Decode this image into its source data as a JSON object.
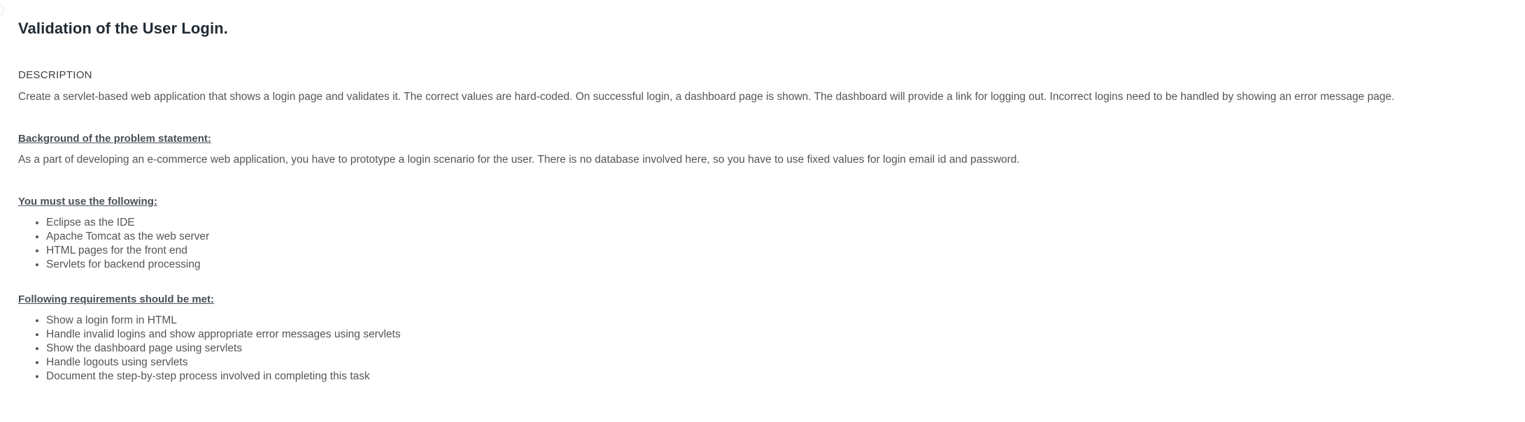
{
  "page": {
    "title": "Validation of the User Login."
  },
  "description": {
    "label": "DESCRIPTION",
    "text": "Create a servlet-based web application that shows a login page and validates it. The correct values are hard-coded. On successful login, a dashboard page is shown. The dashboard will provide a link for logging out. Incorrect logins need to be handled by showing an error message page."
  },
  "background": {
    "heading": "Background of the problem statement:",
    "text": "As a part of developing an e-commerce web application, you have to prototype a login scenario for the user. There is no database involved here, so you have to use fixed values for login email id and password."
  },
  "must_use": {
    "heading": "You must use the following:",
    "items": [
      "Eclipse as the IDE",
      "Apache Tomcat as the web server",
      "HTML pages for the front end",
      "Servlets for backend processing"
    ]
  },
  "requirements": {
    "heading": "Following requirements should be met:",
    "items": [
      "Show a login form in HTML",
      "Handle invalid logins and show appropriate error messages using servlets",
      "Show the dashboard page using servlets",
      "Handle logouts using servlets",
      "Document the step-by-step process involved in completing this task"
    ]
  }
}
